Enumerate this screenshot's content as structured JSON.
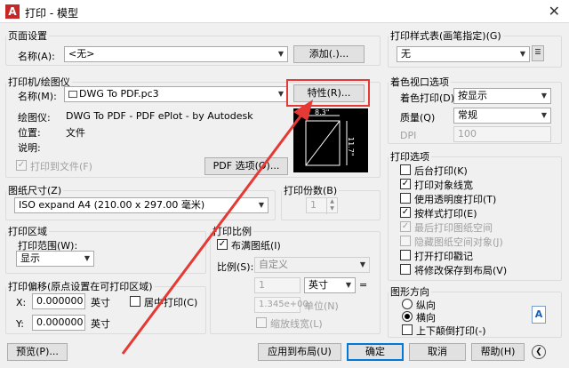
{
  "window": {
    "app_icon": "A",
    "title": "打印 - 模型",
    "close": "✕"
  },
  "page_setup": {
    "group": "页面设置",
    "name_label": "名称(A):",
    "name_value": "<无>",
    "add_button": "添加(.)..."
  },
  "printer": {
    "group": "打印机/绘图仪",
    "name_label": "名称(M):",
    "name_value": "DWG To PDF.pc3",
    "properties_button": "特性(R)...",
    "plotter_label": "绘图仪:",
    "plotter_value": "DWG To PDF - PDF ePlot - by Autodesk",
    "location_label": "位置:",
    "location_value": "文件",
    "desc_label": "说明:",
    "print_to_file": "打印到文件(F)",
    "print_to_file_checked": true,
    "pdf_options_button": "PDF 选项(O)...",
    "preview_width": "8.3\"",
    "preview_height": "11.7\""
  },
  "paper_size": {
    "group": "图纸尺寸(Z)",
    "value": "ISO expand A4 (210.00 x 297.00 毫米)"
  },
  "copies": {
    "group": "打印份数(B)",
    "value": "1"
  },
  "plot_area": {
    "group": "打印区域",
    "range_label": "打印范围(W):",
    "range_value": "显示"
  },
  "plot_scale": {
    "group": "打印比例",
    "fit_label": "布满图纸(I)",
    "fit_checked": true,
    "scale_label": "比例(S):",
    "scale_value": "自定义",
    "num_value": "1",
    "unit_value": "英寸",
    "eq": "=",
    "unit2_value": "1.345e+00",
    "unit2_label": "单位(N)",
    "scale_lineweights": "缩放线宽(L)"
  },
  "plot_offset": {
    "group": "打印偏移(原点设置在可打印区域)",
    "x_label": "X:",
    "x_value": "0.000000",
    "x_unit": "英寸",
    "center_label": "居中打印(C)",
    "y_label": "Y:",
    "y_value": "0.000000",
    "y_unit": "英寸"
  },
  "plot_style": {
    "group": "打印样式表(画笔指定)(G)",
    "value": "无"
  },
  "shaded_viewport": {
    "group": "着色视口选项",
    "shade_label": "着色打印(D)",
    "shade_value": "按显示",
    "quality_label": "质量(Q)",
    "quality_value": "常规",
    "dpi_label": "DPI",
    "dpi_value": "100"
  },
  "plot_options": {
    "group": "打印选项",
    "items": [
      {
        "label": "后台打印(K)",
        "checked": false,
        "disabled": false
      },
      {
        "label": "打印对象线宽",
        "checked": true,
        "disabled": false
      },
      {
        "label": "使用透明度打印(T)",
        "checked": false,
        "disabled": false
      },
      {
        "label": "按样式打印(E)",
        "checked": true,
        "disabled": false
      },
      {
        "label": "最后打印图纸空间",
        "checked": true,
        "disabled": true
      },
      {
        "label": "隐藏图纸空间对象(J)",
        "checked": false,
        "disabled": true
      },
      {
        "label": "打开打印戳记",
        "checked": false,
        "disabled": false
      },
      {
        "label": "将修改保存到布局(V)",
        "checked": false,
        "disabled": false
      }
    ]
  },
  "orientation": {
    "group": "图形方向",
    "portrait": "纵向",
    "landscape": "横向",
    "upside_down": "上下颠倒打印(-)"
  },
  "footer": {
    "preview": "预览(P)...",
    "apply": "应用到布局(U)",
    "ok": "确定",
    "cancel": "取消",
    "help": "帮助(H)"
  },
  "colors": {
    "highlight": "#e53935",
    "accent": "#0078d7"
  }
}
